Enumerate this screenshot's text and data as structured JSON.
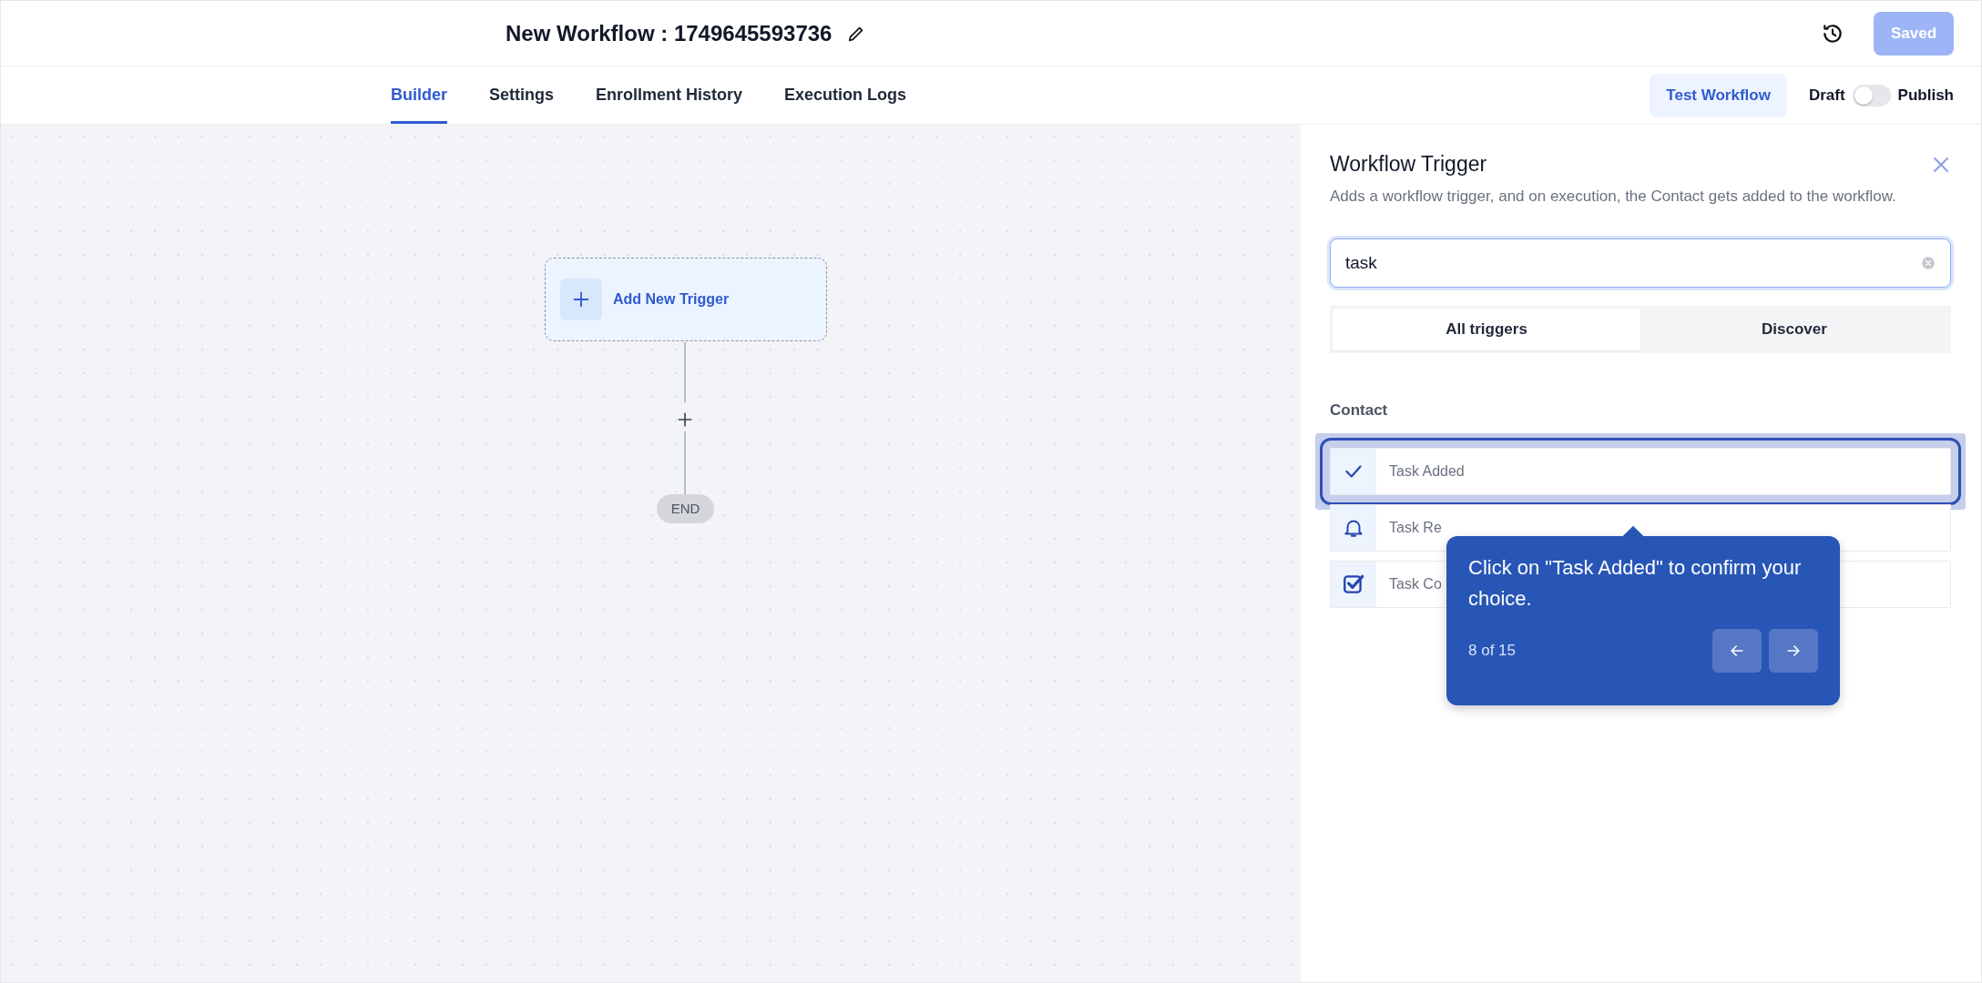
{
  "header": {
    "title": "New Workflow : 1749645593736",
    "save_button": {
      "label": "Saved",
      "disabled": true
    }
  },
  "tabs": [
    {
      "label": "Builder",
      "selected": true
    },
    {
      "label": "Settings",
      "selected": false
    },
    {
      "label": "Enrollment History",
      "selected": false
    },
    {
      "label": "Execution Logs",
      "selected": false
    }
  ],
  "test_button": "Test Workflow",
  "publish_toggle": {
    "off_label": "Draft",
    "on_label": "Publish",
    "on": false
  },
  "canvas": {
    "trigger_node": "Add New Trigger",
    "end_node": "END"
  },
  "panel": {
    "title": "Workflow Trigger",
    "description": "Adds a workflow trigger, and on execution, the Contact gets added to the workflow.",
    "search": {
      "value": "task"
    },
    "segments": [
      {
        "label": "All triggers",
        "selected": true
      },
      {
        "label": "Discover",
        "selected": false
      }
    ],
    "group": "Contact",
    "items": [
      {
        "kind": "check",
        "label": "Task Added",
        "highlighted": true
      },
      {
        "kind": "bell",
        "label": "Task Re",
        "highlighted": false
      },
      {
        "kind": "checkbox",
        "label": "Task Co",
        "highlighted": false
      }
    ]
  },
  "tour": {
    "text": "Click on \"Task Added\" to confirm your choice.",
    "step": "8 of 15"
  }
}
